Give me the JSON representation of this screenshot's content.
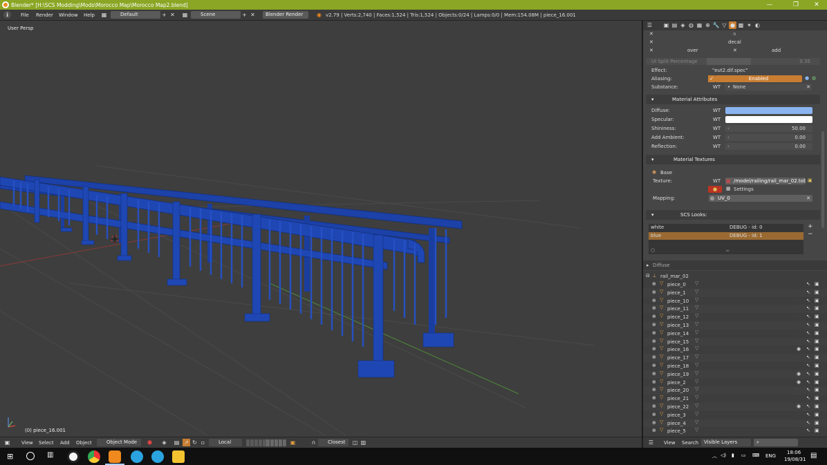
{
  "titlebar": {
    "title": "Blender* [H:\\SCS Modding\\Mods\\Morocco Map\\Morocco Map2.blend]",
    "min": "—",
    "max": "❐",
    "close": "✕"
  },
  "info": {
    "menus": [
      "File",
      "Render",
      "Window",
      "Help"
    ],
    "layout": "Default",
    "scene": "Scene",
    "engine": "Blender Render",
    "stats": "v2.79 | Verts:2,740 | Faces:1,524 | Tris:1,524 | Objects:0/24 | Lamps:0/0 | Mem:154.08M | piece_16.001"
  },
  "viewport": {
    "label": "User Persp",
    "object_label": "(0) piece_16.001",
    "bg": "#3e3e3e",
    "railing_color": "#1f47b4"
  },
  "view_header": {
    "view": "View",
    "select": "Select",
    "add": "Add",
    "object": "Object",
    "mode": "Object Mode",
    "pivot": "Local",
    "snap": "Closest"
  },
  "props": {
    "a_label": "a",
    "decal": "decal",
    "over": "over",
    "add": "add",
    "ui_split_label": "UI Split Percentage",
    "ui_split_value": "0.35",
    "effect_label": "Effect:",
    "effect_value": "\"eut2.dif.spec\"",
    "aliasing_label": "Aliasing:",
    "aliasing_value": "Enabled",
    "substance_label": "Substance:",
    "substance_value": "None",
    "wt": "WT",
    "mat_attr_title": "Material Attributes",
    "diffuse_label": "Diffuse:",
    "specular_label": "Specular:",
    "shininess_label": "Shininess:",
    "shininess_value": "50.00",
    "add_ambient_label": "Add Ambient:",
    "add_ambient_value": "0.00",
    "reflection_label": "Reflection:",
    "reflection_value": "0.00",
    "mat_tex_title": "Material Textures",
    "base_label": "Base",
    "texture_label": "Texture:",
    "texture_value": "/model/railing/rail_mar_02.tobj",
    "settings_label": "Settings",
    "mapping_label": "Mapping:",
    "mapping_value": "UV_0",
    "scs_looks_title": "SCS Looks:",
    "looks": [
      {
        "name": "white",
        "debug": "DEBUG - id: 0"
      },
      {
        "name": "blue",
        "debug": "DEBUG - id: 1"
      }
    ],
    "diffuse_panel": "Diffuse",
    "colors": {
      "accent": "#c87d32",
      "diffuse": "#8ab4f0",
      "specular": "#ffffff",
      "selected_look": "#9a6a32"
    }
  },
  "outliner": {
    "root": "rail_mar_02",
    "items": [
      {
        "name": "piece_0",
        "visible": false
      },
      {
        "name": "piece_1",
        "visible": false
      },
      {
        "name": "piece_10",
        "visible": false
      },
      {
        "name": "piece_11",
        "visible": false
      },
      {
        "name": "piece_12",
        "visible": false
      },
      {
        "name": "piece_13",
        "visible": false
      },
      {
        "name": "piece_14",
        "visible": false
      },
      {
        "name": "piece_15",
        "visible": false
      },
      {
        "name": "piece_16",
        "visible": true
      },
      {
        "name": "piece_17",
        "visible": false
      },
      {
        "name": "piece_18",
        "visible": false
      },
      {
        "name": "piece_19",
        "visible": true
      },
      {
        "name": "piece_2",
        "visible": true
      },
      {
        "name": "piece_20",
        "visible": false
      },
      {
        "name": "piece_21",
        "visible": false
      },
      {
        "name": "piece_22",
        "visible": true
      },
      {
        "name": "piece_3",
        "visible": false
      },
      {
        "name": "piece_4",
        "visible": false
      },
      {
        "name": "piece_5",
        "visible": false
      }
    ]
  },
  "outliner_header": {
    "view": "View",
    "search": "Search",
    "layers": "Visible Layers"
  },
  "taskbar": {
    "lang": "ENG",
    "time": "18:06",
    "date": "19/08/31"
  }
}
